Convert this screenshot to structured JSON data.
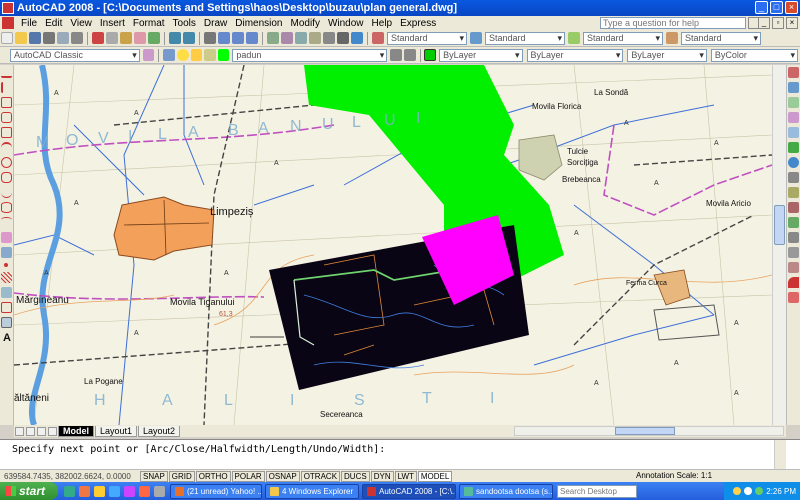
{
  "window": {
    "title": "AutoCAD 2008 - [C:\\Documents and Settings\\haos\\Desktop\\buzau\\plan general.dwg]",
    "minimize_label": "_",
    "maximize_label": "□",
    "close_label": "×"
  },
  "menu": {
    "items": [
      "File",
      "Edit",
      "View",
      "Insert",
      "Format",
      "Tools",
      "Draw",
      "Dimension",
      "Modify",
      "Window",
      "Help",
      "Express"
    ],
    "help_placeholder": "Type a question for help"
  },
  "toolbar1": {
    "textstyle": "Standard",
    "dimstyle": "Standard",
    "tablestyle": "Standard",
    "mleaderstyle": "Standard"
  },
  "toolbar2": {
    "workspace": "AutoCAD Classic",
    "layer": "padun",
    "color": "ByLayer",
    "linetype": "ByLayer",
    "lineweight": "ByLayer",
    "plotstyle": "ByColor"
  },
  "map_labels": {
    "limpezis": "Limpeziș",
    "marginean": "Mărgineanu",
    "movila_tiganului": "Movila  Tiganului",
    "elev_613": "61,3",
    "la_pogane": "La Pogane",
    "saltaneni": "ăltăneni",
    "secerenca": "Secereanca",
    "movila_florica": "Movila Florica",
    "la_sonda": "La Sondă",
    "tulcie": "Tulcie",
    "sorcitoga": "Sorcițiga",
    "brebeanca": "Brebeanca",
    "movila_aricio": "Movila Aricio",
    "ferma_curca": "Ferma\nCurca",
    "big_letters": [
      "M",
      "O",
      "V",
      "I",
      "L",
      "A",
      "B",
      "A",
      "N",
      "U",
      "L",
      "U",
      "I"
    ],
    "big_letters_bottom": [
      "H",
      "A",
      "L",
      "I",
      "S",
      "T",
      "I"
    ]
  },
  "tabs": {
    "model": "Model",
    "layout1": "Layout1",
    "layout2": "Layout2"
  },
  "command": {
    "prompt": "Specify next point or [Arc/Close/Halfwidth/Length/Undo/Width]:"
  },
  "status": {
    "coords": "639584.7435, 382002.6624, 0.0000",
    "buttons": [
      "SNAP",
      "GRID",
      "ORTHO",
      "POLAR",
      "OSNAP",
      "OTRACK",
      "DUCS",
      "DYN",
      "LWT",
      "MODEL"
    ],
    "annotation_scale": "Annotation Scale:  1:1"
  },
  "taskbar": {
    "start": "start",
    "tasks": [
      {
        "label": "(21 unread) Yahoo! ...",
        "color": "#e8702a"
      },
      {
        "label": "4 Windows Explorer",
        "color": "#f3c74a"
      },
      {
        "label": "AutoCAD 2008 - [C:\\...",
        "color": "#c33"
      },
      {
        "label": "sandootsa dootsa (s...",
        "color": "#5b9"
      }
    ],
    "search_placeholder": "Search Desktop",
    "clock": "2:26 PM"
  }
}
